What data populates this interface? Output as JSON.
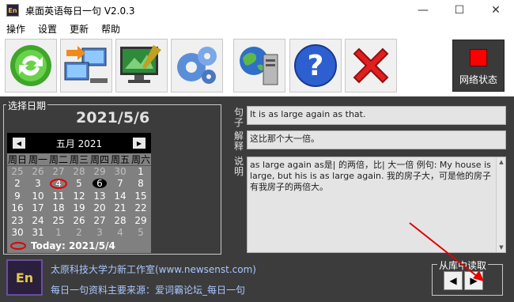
{
  "window": {
    "title": "桌面英语每日一句 V2.0.3",
    "app_icon": "En",
    "controls": {
      "minimize": "—",
      "maximize": "☐",
      "close": "✕"
    }
  },
  "menu": [
    "操作",
    "设置",
    "更新",
    "帮助"
  ],
  "toolbar": {
    "buttons": [
      {
        "name": "refresh-icon"
      },
      {
        "name": "network-transfer-icon"
      },
      {
        "name": "monitor-paint-icon"
      },
      {
        "name": "settings-gears-icon"
      },
      {
        "name": "globe-server-icon"
      },
      {
        "name": "help-icon"
      },
      {
        "name": "close-x-icon"
      }
    ],
    "network_status": {
      "label": "网络状态",
      "color": "#ff0000"
    }
  },
  "date_panel": {
    "title": "选择日期",
    "big_date": "2021/5/6",
    "calendar": {
      "month_label": "五月 2021",
      "prev": "◀",
      "next": "▶",
      "weekdays": [
        "周日",
        "周一",
        "周二",
        "周三",
        "周四",
        "周五",
        "周六"
      ],
      "days": [
        "25",
        "26",
        "27",
        "28",
        "29",
        "30",
        "1",
        "2",
        "3",
        "4",
        "5",
        "6",
        "7",
        "8",
        "9",
        "10",
        "11",
        "12",
        "13",
        "14",
        "15",
        "16",
        "17",
        "18",
        "19",
        "20",
        "21",
        "22",
        "23",
        "24",
        "25",
        "26",
        "27",
        "28",
        "29",
        "30",
        "31",
        "1",
        "2",
        "3",
        "4",
        "5"
      ],
      "selected_day": "6",
      "today_day": "4",
      "today_label": "Today: 2021/5/4"
    }
  },
  "sentence": {
    "label": "句子",
    "text": "It is as large again as that."
  },
  "explanation": {
    "label": "解释",
    "text": "这比那个大一倍。"
  },
  "notes": {
    "label": "说明",
    "text": "as large again as是| 的两倍，比| 大一倍 例句:   My house is large, but his is as large again.  我的房子大，可是他的房子有我房子的两倍大。"
  },
  "footer": {
    "logo_text": "En",
    "line1": "太原科技大学力新工作室(www.newsenst.com)",
    "line2": "每日一句资料主要来源：爱词霸论坛_每日一句"
  },
  "library": {
    "title": "从库中读取",
    "prev": "◀",
    "next": "▶"
  },
  "colors": {
    "accent_red": "#e00000",
    "link_blue": "#a9c8ff",
    "bg_dark": "#3c3c3c"
  }
}
